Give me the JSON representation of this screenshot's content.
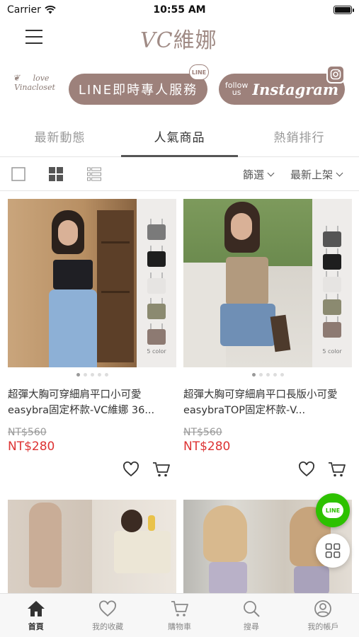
{
  "status_bar": {
    "carrier": "Carrier",
    "time": "10:55 AM"
  },
  "header": {
    "logo_latin": "VC",
    "logo_zh": "維娜",
    "menu_icon": "hamburger-icon"
  },
  "promo": {
    "script_logo": [
      "love",
      "Vinacloset"
    ],
    "line_button": "LINE即時專人服務",
    "line_badge": "LINE",
    "instagram_follow": [
      "follow",
      "us"
    ],
    "instagram_label": "Instagram"
  },
  "tabs": [
    {
      "label": "最新動態",
      "active": false
    },
    {
      "label": "人氣商品",
      "active": true
    },
    {
      "label": "熱銷排行",
      "active": false
    }
  ],
  "toolbar": {
    "view_icons": [
      "single-view-icon",
      "grid-view-icon",
      "list-view-icon"
    ],
    "filter_label": "篩選",
    "sort_label": "最新上架"
  },
  "products": [
    {
      "title": "超彈大胸可穿細肩平口小可愛easybra固定杯款-VC維娜 36...",
      "old_price": "NT$560",
      "price": "NT$280",
      "swatch_label": "5 color",
      "swatches": [
        "#7a7a7a",
        "#1e1e1e",
        "#e6e4e2",
        "#8b8a70",
        "#8d7a72"
      ]
    },
    {
      "title": "超彈大胸可穿細肩平口長版小可愛easybraTOP固定杯款-V...",
      "old_price": "NT$560",
      "price": "NT$280",
      "swatch_label": "5 color",
      "swatches": [
        "#555555",
        "#1e1e1e",
        "#e6e4e2",
        "#8b8a70",
        "#8d7a72"
      ]
    }
  ],
  "bottom_nav": [
    {
      "label": "首頁",
      "icon": "home-icon",
      "active": true
    },
    {
      "label": "我的收藏",
      "icon": "heart-icon",
      "active": false
    },
    {
      "label": "購物車",
      "icon": "cart-icon",
      "active": false
    },
    {
      "label": "搜尋",
      "icon": "search-icon",
      "active": false
    },
    {
      "label": "我的帳戶",
      "icon": "account-icon",
      "active": false
    }
  ],
  "floating": {
    "line_label": "LINE"
  },
  "colors": {
    "brand": "#9d817b",
    "sale_price": "#d33333",
    "line_green": "#2dc100"
  }
}
